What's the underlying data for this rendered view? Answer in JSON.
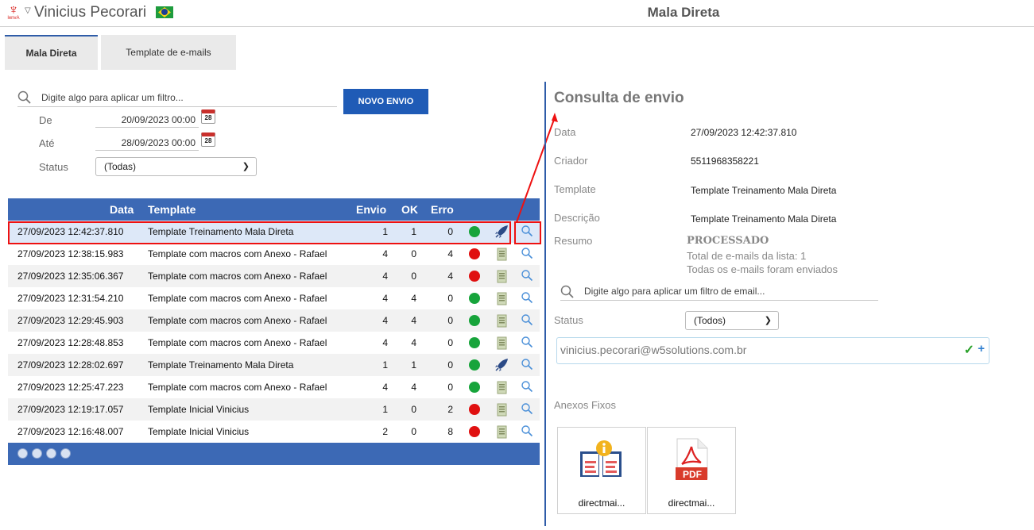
{
  "header": {
    "user_name": "Vinicius Pecorari",
    "page_title": "Mala Direta",
    "logo_text": "lenvA"
  },
  "tabs": [
    {
      "label": "Mala Direta",
      "active": true
    },
    {
      "label": "Template de e-mails",
      "active": false
    }
  ],
  "filters": {
    "search_placeholder": "Digite algo para aplicar um filtro...",
    "new_button": "NOVO ENVIO",
    "from_label": "De",
    "from_value": "20/09/2023 00:00",
    "to_label": "Até",
    "to_value": "28/09/2023 00:00",
    "calendar_day": "28",
    "status_label": "Status",
    "status_value": "(Todas)"
  },
  "table": {
    "headers": {
      "date": "Data",
      "template": "Template",
      "envio": "Envio",
      "ok": "OK",
      "erro": "Erro"
    },
    "rows": [
      {
        "date": "27/09/2023 12:42:37.810",
        "template": "Template Treinamento Mala Direta",
        "envio": "1",
        "ok": "1",
        "erro": "0",
        "status": "green",
        "action": "rocket"
      },
      {
        "date": "27/09/2023 12:38:15.983",
        "template": "Template com macros com Anexo - Rafael",
        "envio": "4",
        "ok": "0",
        "erro": "4",
        "status": "red",
        "action": "doc"
      },
      {
        "date": "27/09/2023 12:35:06.367",
        "template": "Template com macros com Anexo - Rafael",
        "envio": "4",
        "ok": "0",
        "erro": "4",
        "status": "red",
        "action": "doc"
      },
      {
        "date": "27/09/2023 12:31:54.210",
        "template": "Template com macros com Anexo - Rafael",
        "envio": "4",
        "ok": "4",
        "erro": "0",
        "status": "green",
        "action": "doc"
      },
      {
        "date": "27/09/2023 12:29:45.903",
        "template": "Template com macros com Anexo - Rafael",
        "envio": "4",
        "ok": "4",
        "erro": "0",
        "status": "green",
        "action": "doc"
      },
      {
        "date": "27/09/2023 12:28:48.853",
        "template": "Template com macros com Anexo - Rafael",
        "envio": "4",
        "ok": "4",
        "erro": "0",
        "status": "green",
        "action": "doc"
      },
      {
        "date": "27/09/2023 12:28:02.697",
        "template": "Template Treinamento Mala Direta",
        "envio": "1",
        "ok": "1",
        "erro": "0",
        "status": "green",
        "action": "rocket"
      },
      {
        "date": "27/09/2023 12:25:47.223",
        "template": "Template com macros com Anexo - Rafael",
        "envio": "4",
        "ok": "4",
        "erro": "0",
        "status": "green",
        "action": "doc"
      },
      {
        "date": "27/09/2023 12:19:17.057",
        "template": "Template Inicial Vinicius",
        "envio": "1",
        "ok": "0",
        "erro": "2",
        "status": "red",
        "action": "doc"
      },
      {
        "date": "27/09/2023 12:16:48.007",
        "template": "Template Inicial Vinicius",
        "envio": "2",
        "ok": "0",
        "erro": "8",
        "status": "red",
        "action": "doc"
      }
    ]
  },
  "detail": {
    "title": "Consulta de envio",
    "data_label": "Data",
    "data_value": "27/09/2023 12:42:37.810",
    "criador_label": "Criador",
    "criador_value": "5511968358221",
    "template_label": "Template",
    "template_value": "Template Treinamento Mala Direta",
    "descricao_label": "Descrição",
    "descricao_value": "Template Treinamento Mala Direta",
    "resumo_label": "Resumo",
    "resumo_status": "PROCESSADO",
    "resumo_line1": "Total de e-mails da lista: 1",
    "resumo_line2": "Todas os e-mails foram enviados",
    "email_filter_placeholder": "Digite algo para aplicar um filtro de email...",
    "status_label": "Status",
    "status_value": "(Todos)",
    "email": "vinicius.pecorari@w5solutions.com.br",
    "anexos_label": "Anexos Fixos",
    "attachments": [
      {
        "name": "directmai..."
      },
      {
        "name": "directmai..."
      }
    ],
    "pdf_text": "PDF"
  },
  "colors": {
    "accent": "#1f5bb6",
    "grid_header": "#3c69b5",
    "ok": "#17a43b",
    "error": "#e01010",
    "highlight": "#ee1111"
  }
}
